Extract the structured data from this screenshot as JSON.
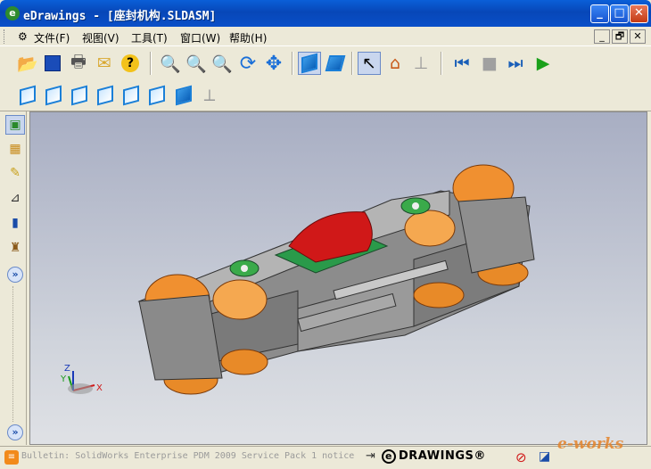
{
  "window": {
    "title": "eDrawings - [座封机构.SLDASM]",
    "app_icon": "e"
  },
  "window_controls": {
    "minimize": "_",
    "maximize": "□",
    "close": "✕"
  },
  "menu": {
    "items": [
      "文件(F)",
      "视图(V)",
      "工具(T)",
      "窗口(W)",
      "帮助(H)"
    ],
    "mdi": {
      "minimize": "_",
      "restore": "🗗",
      "close": "✕"
    }
  },
  "toolbar1": {
    "icons": [
      "open-icon",
      "save-icon",
      "print-icon",
      "email-icon",
      "help-icon",
      "zoom-to-fit-icon",
      "zoom-area-icon",
      "zoom-icon",
      "rotate-icon",
      "pan-icon",
      "shaded-view-icon",
      "previous-view-icon",
      "select-icon",
      "home-icon",
      "explode-icon",
      "first-frame-icon",
      "stop-icon",
      "next-frame-icon",
      "play-icon"
    ]
  },
  "toolbar2": {
    "icons": [
      "front-view-icon",
      "back-view-icon",
      "left-view-icon",
      "right-view-icon",
      "top-view-icon",
      "bottom-view-icon",
      "isometric-view-icon",
      "plane-icon"
    ]
  },
  "sidebar": {
    "icons": [
      "components-icon",
      "configurations-icon",
      "markup-icon",
      "measure-icon",
      "section-icon",
      "stamp-icon"
    ],
    "expand": "»"
  },
  "axes": {
    "x": "X",
    "y": "Y",
    "z": "Z"
  },
  "status": {
    "bulletin": "Bulletin: SolidWorks Enterprise PDM 2009 Service Pack 1 notice",
    "brand": "DRAWINGS®",
    "brand_letter": "e",
    "watermark": "e-works"
  },
  "colors": {
    "titlebar": "#0a4fc8",
    "accent_orange": "#f09030",
    "body_gray": "#8c8c8c",
    "cap_red": "#d01818"
  }
}
